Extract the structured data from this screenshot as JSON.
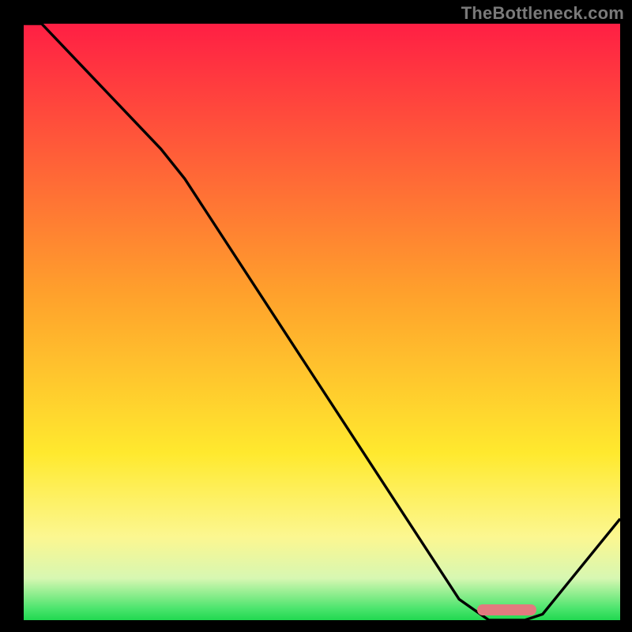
{
  "attribution": "TheBottleneck.com",
  "colors": {
    "red": "#ff1f44",
    "orange": "#ff9a2a",
    "yellow": "#ffe92e",
    "yellow_pale": "#fcf799",
    "green_pale": "#d4f7b0",
    "green": "#28e05a",
    "curve": "#000000",
    "marker": "#e27a7f",
    "frame": "#000000",
    "attrib": "#7a7a7a"
  },
  "chart_data": {
    "type": "line",
    "title": "",
    "xlabel": "",
    "ylabel": "",
    "xlim": [
      0,
      100
    ],
    "ylim": [
      0,
      100
    ],
    "x": [
      0,
      3,
      23,
      27,
      73,
      78,
      84,
      87,
      100
    ],
    "values": [
      103,
      100,
      79,
      74,
      3.5,
      0,
      0,
      1,
      17
    ],
    "optimal_range": {
      "x_start": 76,
      "x_end": 86,
      "y": 0.8
    },
    "background_gradient_stops": [
      {
        "pct": 0,
        "color": "#ff1f44"
      },
      {
        "pct": 45,
        "color": "#ffa02c"
      },
      {
        "pct": 72,
        "color": "#ffe92e"
      },
      {
        "pct": 86,
        "color": "#fcf790"
      },
      {
        "pct": 93,
        "color": "#d7f7b2"
      },
      {
        "pct": 98,
        "color": "#4de56e"
      },
      {
        "pct": 100,
        "color": "#20d850"
      }
    ]
  }
}
